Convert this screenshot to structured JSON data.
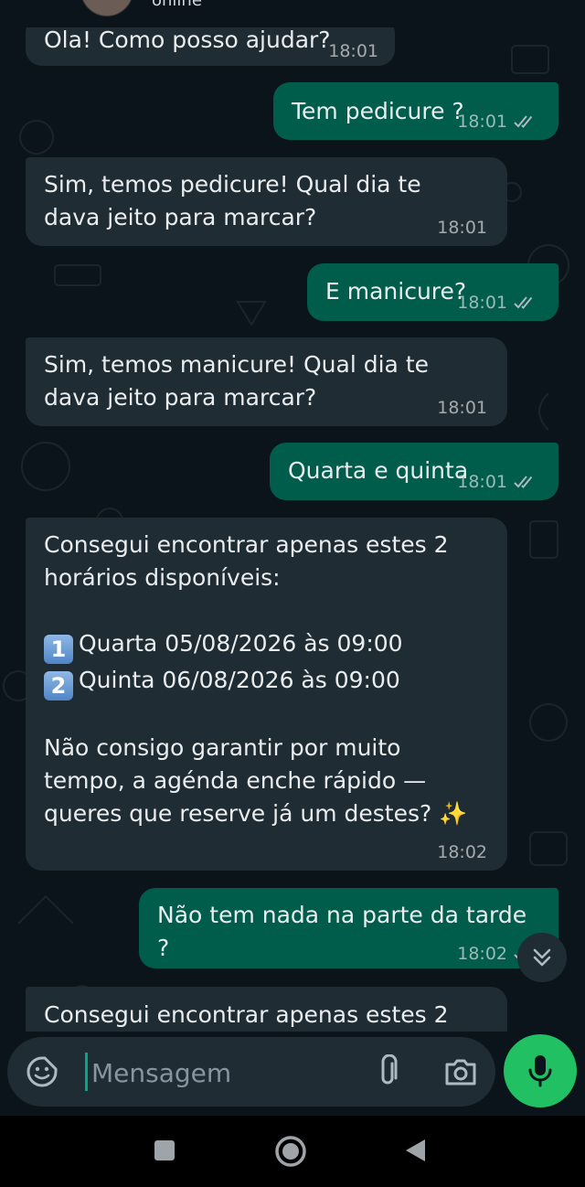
{
  "header": {
    "status": "online"
  },
  "messages": [
    {
      "dir": "in",
      "text": "Ola! Como posso ajudar?",
      "time": "18:01"
    },
    {
      "dir": "out",
      "text": "Tem pedicure ?",
      "time": "18:01"
    },
    {
      "dir": "in",
      "text": "Sim, temos pedicure! Qual dia te dava jeito para marcar?",
      "time": "18:01"
    },
    {
      "dir": "out",
      "text": "E manicure?",
      "time": "18:01"
    },
    {
      "dir": "in",
      "text": "Sim, temos manicure! Qual dia te dava jeito para marcar?",
      "time": "18:01"
    },
    {
      "dir": "out",
      "text": "Quarta e quinta",
      "time": "18:01"
    },
    {
      "dir": "in",
      "intro": "Consegui encontrar apenas estes 2 horários disponíveis:",
      "options": [
        {
          "badge": "1",
          "text": "Quarta 05/08/2026 às 09:00"
        },
        {
          "badge": "2",
          "text": "Quinta 06/08/2026 às 09:00"
        }
      ],
      "outro": "Não consigo garantir por muito tempo, a agénda enche rápido — queres que reserve já um destes? ✨",
      "time": "18:02"
    },
    {
      "dir": "out",
      "text": "Não tem nada na parte da tarde ?",
      "time": "18:02"
    },
    {
      "dir": "in",
      "text": "Consegui encontrar apenas estes 2"
    }
  ],
  "input": {
    "placeholder": "Mensagem"
  },
  "colors": {
    "incoming": "#202c33",
    "outgoing": "#005c4b",
    "accent": "#21c063",
    "read_ticks": "#8696a0"
  },
  "icons": [
    "sticker-icon",
    "attach-icon",
    "camera-icon",
    "mic-icon",
    "scroll-down-icon",
    "nav-square-icon",
    "nav-circle-icon",
    "nav-back-icon"
  ]
}
